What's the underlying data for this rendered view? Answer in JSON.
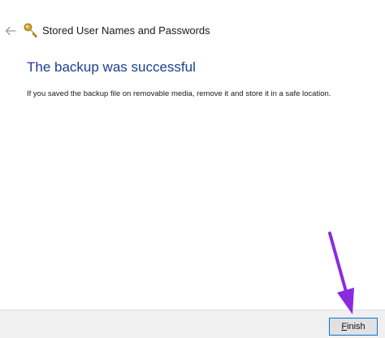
{
  "window": {
    "title": "Stored User Names and Passwords"
  },
  "content": {
    "heading": "The backup was successful",
    "message": "If you saved the backup file on removable media, remove it and store it in a safe location."
  },
  "footer": {
    "finish_label_mnemonic": "F",
    "finish_label_rest": "inish"
  },
  "icons": {
    "back": "back-arrow-icon",
    "app": "key-icon",
    "annotation": "purple-arrow-annotation"
  },
  "colors": {
    "heading": "#1a3f8f",
    "button_border": "#0078d7",
    "annotation": "#8a2be2",
    "footer_bg": "#f0f0f0"
  }
}
